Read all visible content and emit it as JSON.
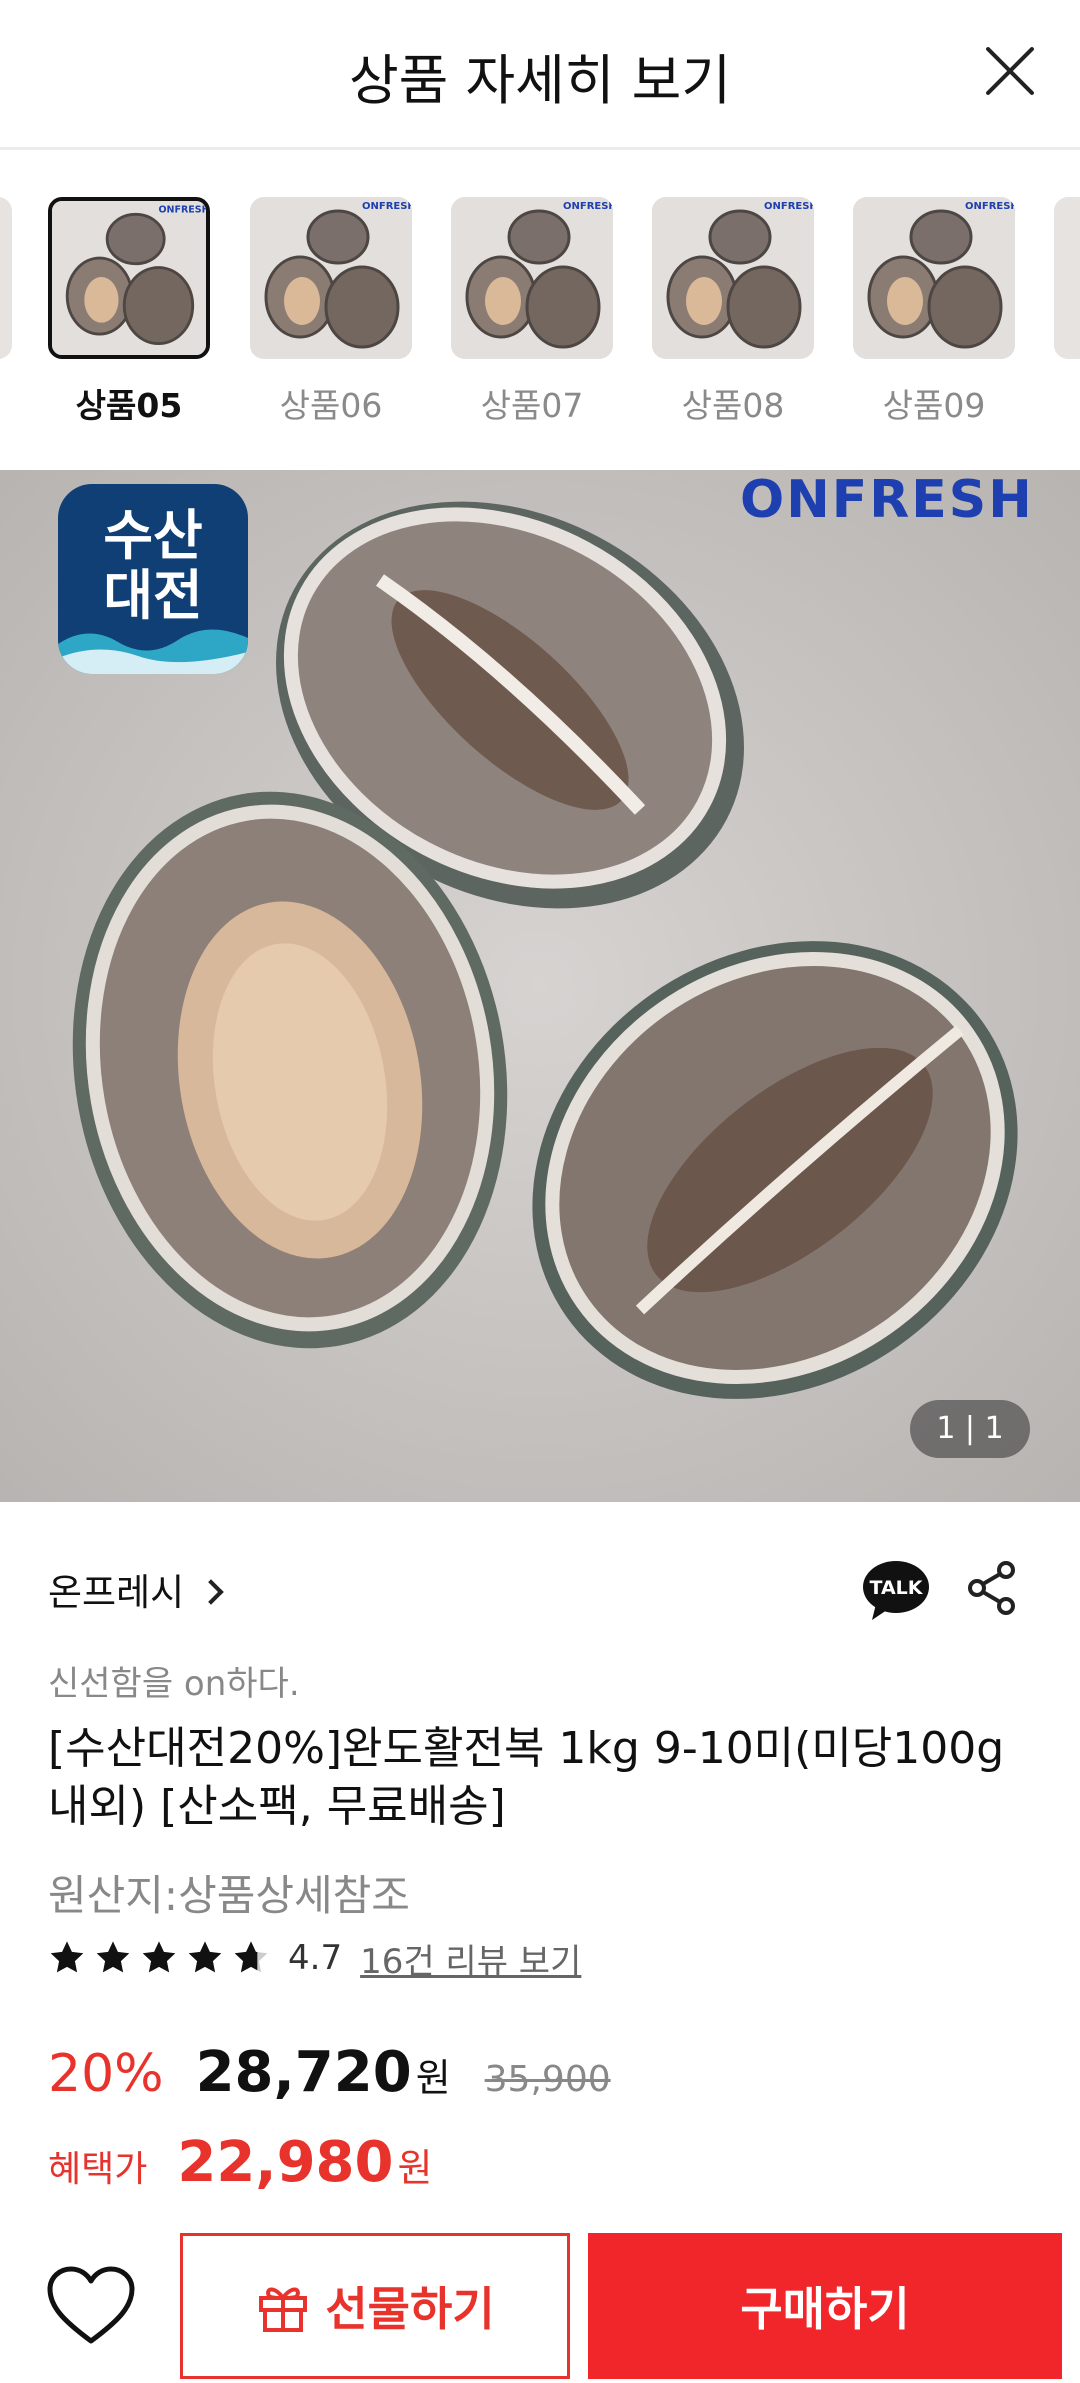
{
  "header": {
    "title": "상품 자세히 보기"
  },
  "thumbnails": [
    {
      "label": "상품05",
      "active": true
    },
    {
      "label": "상품06",
      "active": false
    },
    {
      "label": "상품07",
      "active": false
    },
    {
      "label": "상품08",
      "active": false
    },
    {
      "label": "상품09",
      "active": false
    }
  ],
  "image": {
    "badge_text_line1": "수산",
    "badge_text_line2": "대전",
    "brand_mark": "ONFRESH",
    "thumb_mark": "ONFRESH",
    "counter": "1 | 1"
  },
  "seller": {
    "name": "온프레시",
    "tagline": "신선함을 on하다."
  },
  "talk_label": "TALK",
  "product": {
    "name": "[수산대전20%]완도활전복 1kg 9-10미(미당100g 내외) [산소팩, 무료배송]",
    "origin": "원산지:상품상세참조",
    "rating": "4.7",
    "review_link": "16건 리뷰 보기"
  },
  "pricing": {
    "discount": "20%",
    "price": "28,720",
    "currency": "원",
    "original_price": "35,900",
    "benefit_label": "혜택가",
    "benefit_price": "22,980"
  },
  "actions": {
    "gift_label": "선물하기",
    "buy_label": "구매하기"
  },
  "colors": {
    "accent": "#e8322c",
    "buy_button": "#f0262a",
    "badge": "#0f3f74"
  }
}
